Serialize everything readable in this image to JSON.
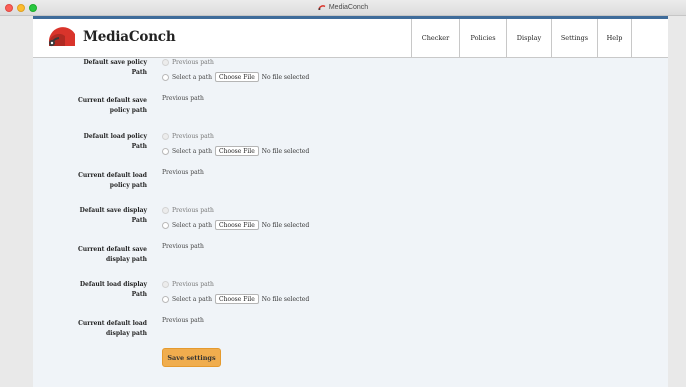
{
  "window": {
    "title": "MediaConch"
  },
  "brand": {
    "name": "MediaConch"
  },
  "nav": [
    {
      "label": "Checker"
    },
    {
      "label": "Policies"
    },
    {
      "label": "Display"
    },
    {
      "label": "Settings"
    },
    {
      "label": "Help"
    }
  ],
  "colors": {
    "accent_bar": "#3f6c9a",
    "button": "#f0ad4e",
    "logo_red": "#d9342b",
    "logo_dark": "#3a3a3a",
    "logo_teal": "#3a8a8a"
  },
  "form": {
    "groups": [
      {
        "label_line1": "Default save policy",
        "label_line2": "Path",
        "option_previous": "Previous path",
        "option_select": "Select a path",
        "file_button": "Choose File",
        "file_status": "No file selected",
        "current_label_line1": "Current default save",
        "current_label_line2": "policy path",
        "current_value": "Previous path"
      },
      {
        "label_line1": "Default load policy",
        "label_line2": "Path",
        "option_previous": "Previous path",
        "option_select": "Select a path",
        "file_button": "Choose File",
        "file_status": "No file selected",
        "current_label_line1": "Current default load",
        "current_label_line2": "policy path",
        "current_value": "Previous path"
      },
      {
        "label_line1": "Default save display",
        "label_line2": "Path",
        "option_previous": "Previous path",
        "option_select": "Select a path",
        "file_button": "Choose File",
        "file_status": "No file selected",
        "current_label_line1": "Current default save",
        "current_label_line2": "display path",
        "current_value": "Previous path"
      },
      {
        "label_line1": "Default load display",
        "label_line2": "Path",
        "option_previous": "Previous path",
        "option_select": "Select a path",
        "file_button": "Choose File",
        "file_status": "No file selected",
        "current_label_line1": "Current default load",
        "current_label_line2": "display path",
        "current_value": "Previous path"
      }
    ],
    "save_button": "Save settings"
  }
}
